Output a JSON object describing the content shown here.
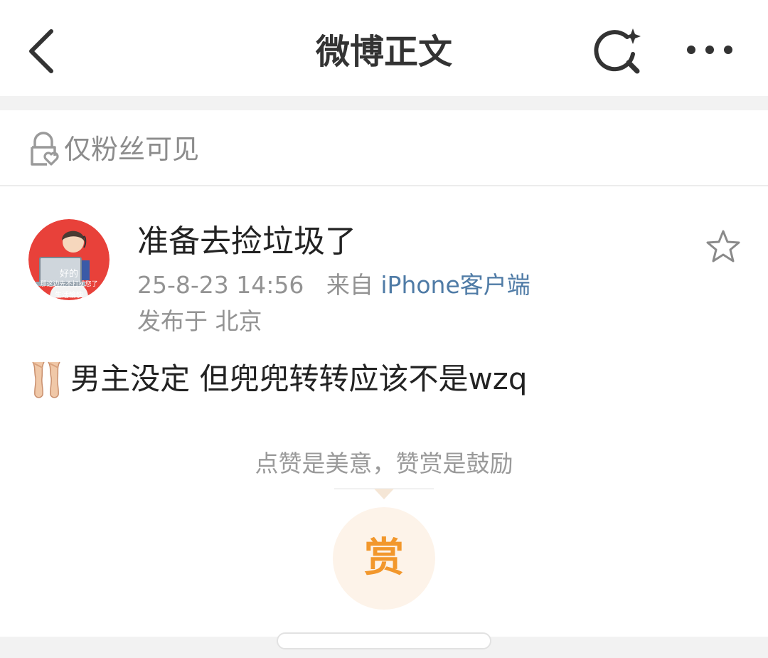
{
  "navbar": {
    "title": "微博正文",
    "back_icon": "chevron-left-icon",
    "search_icon": "search-sparkle-icon",
    "more_icon": "more-dots-icon"
  },
  "visibility": {
    "icon": "lock-heart-icon",
    "label": "仅粉丝可见"
  },
  "post": {
    "author": "准备去捡垃圾了",
    "avatar_text": [
      "好的",
      "那这边先不打扰您了",
      "生活愉快"
    ],
    "timestamp": "25-8-23 14:56",
    "source_prefix": "来自",
    "source_name": "iPhone客户端",
    "location": "发布于 北京",
    "favorite_icon": "star-outline-icon",
    "body_emoji_icon": "ballet-shoes-icon",
    "body_text": "男主没定 但兜兜转转应该不是wzq"
  },
  "reward": {
    "caption": "点赞是美意，赞赏是鼓励",
    "button_label": "赏"
  },
  "colors": {
    "title_text": "#333333",
    "secondary_text": "#939393",
    "link_blue": "#4f7ba6",
    "reward_orange": "#f2972c",
    "reward_bg": "#fdf3e9",
    "avatar_red": "#e8413a",
    "separator_gray": "#f2f2f2"
  }
}
